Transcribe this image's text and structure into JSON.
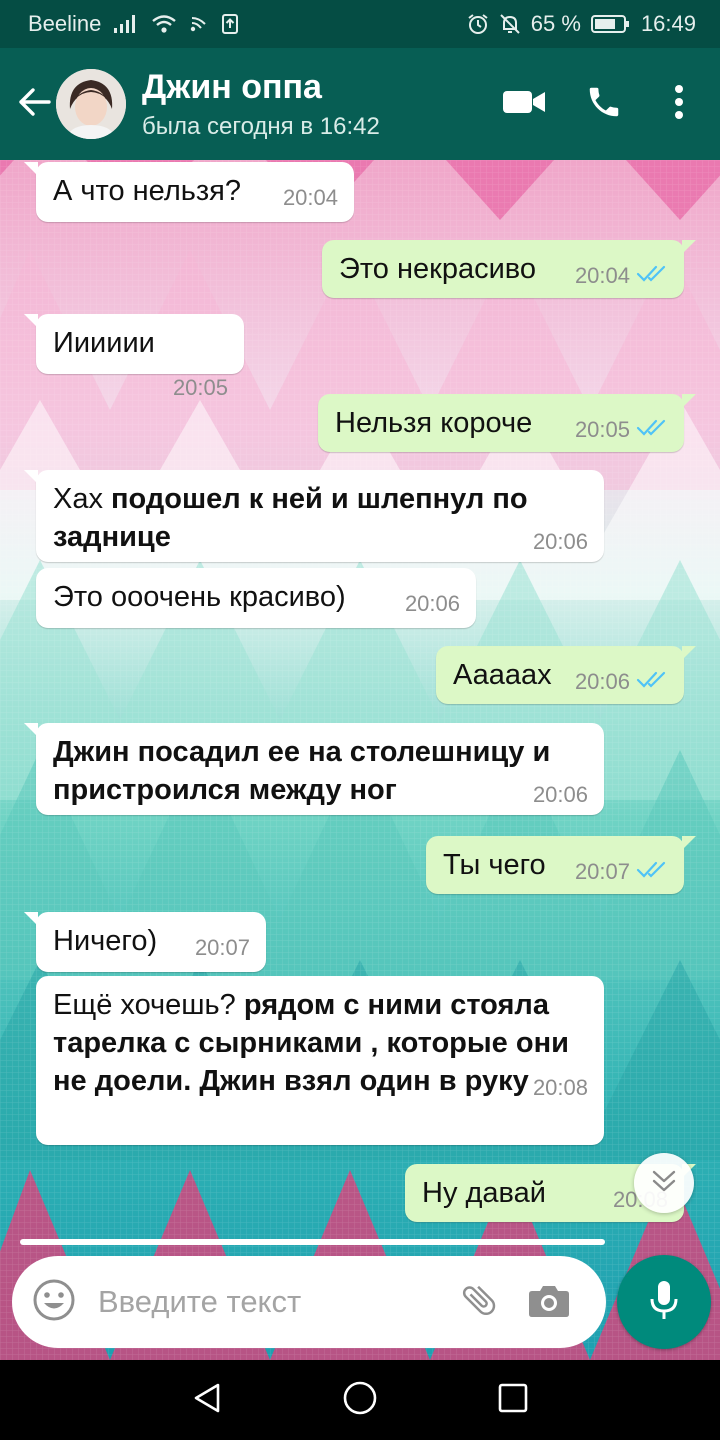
{
  "status_bar": {
    "carrier": "Beeline",
    "battery": "65 %",
    "time": "16:49"
  },
  "header": {
    "contact_name": "Джин оппа",
    "last_seen": "была сегодня в 16:42",
    "icons": [
      "back-arrow-icon",
      "video-call-icon",
      "phone-icon",
      "more-vert-icon"
    ]
  },
  "messages": [
    {
      "dir": "in",
      "segments": [
        {
          "t": "А что нельзя?",
          "b": false
        }
      ],
      "time": "20:04"
    },
    {
      "dir": "out",
      "segments": [
        {
          "t": "Это некрасиво",
          "b": false
        }
      ],
      "time": "20:04",
      "read": true
    },
    {
      "dir": "in",
      "segments": [
        {
          "t": "Ииииии",
          "b": false
        }
      ],
      "time": "20:05"
    },
    {
      "dir": "out",
      "segments": [
        {
          "t": "Нельзя короче",
          "b": false
        }
      ],
      "time": "20:05",
      "read": true
    },
    {
      "dir": "in",
      "segments": [
        {
          "t": "Хах ",
          "b": false
        },
        {
          "t": "подошел к ней и шлепнул по заднице",
          "b": true
        }
      ],
      "time": "20:06"
    },
    {
      "dir": "in",
      "segments": [
        {
          "t": "Это ооочень красиво)",
          "b": false
        }
      ],
      "time": "20:06"
    },
    {
      "dir": "out",
      "segments": [
        {
          "t": "Аааааx",
          "b": false
        }
      ],
      "time": "20:06",
      "read": true
    },
    {
      "dir": "in",
      "segments": [
        {
          "t": "Джин посадил ее на столешницу и пристроился между ног",
          "b": true
        }
      ],
      "time": "20:06"
    },
    {
      "dir": "out",
      "segments": [
        {
          "t": "Ты чего",
          "b": false
        }
      ],
      "time": "20:07",
      "read": true
    },
    {
      "dir": "in",
      "segments": [
        {
          "t": "Ничего)",
          "b": false
        }
      ],
      "time": "20:07"
    },
    {
      "dir": "in",
      "segments": [
        {
          "t": "Ещё хочешь? ",
          "b": false
        },
        {
          "t": "рядом с ними стояла тарелка с сырниками , которые они не доели. Джин взял один в руку",
          "b": true
        }
      ],
      "time": "20:08"
    },
    {
      "dir": "out",
      "segments": [
        {
          "t": "Ну давай",
          "b": false
        }
      ],
      "time": "20:08",
      "read": true
    }
  ],
  "composer": {
    "placeholder": "Введите текст",
    "icons": [
      "emoji-icon",
      "attach-icon",
      "camera-icon",
      "mic-icon"
    ]
  },
  "colors": {
    "header": "#075e54",
    "status_bar": "#054d44",
    "outgoing_bubble": "#dcf8c6",
    "incoming_bubble": "#ffffff",
    "read_ticks": "#4fc3f7",
    "mic_button": "#008a7c"
  }
}
